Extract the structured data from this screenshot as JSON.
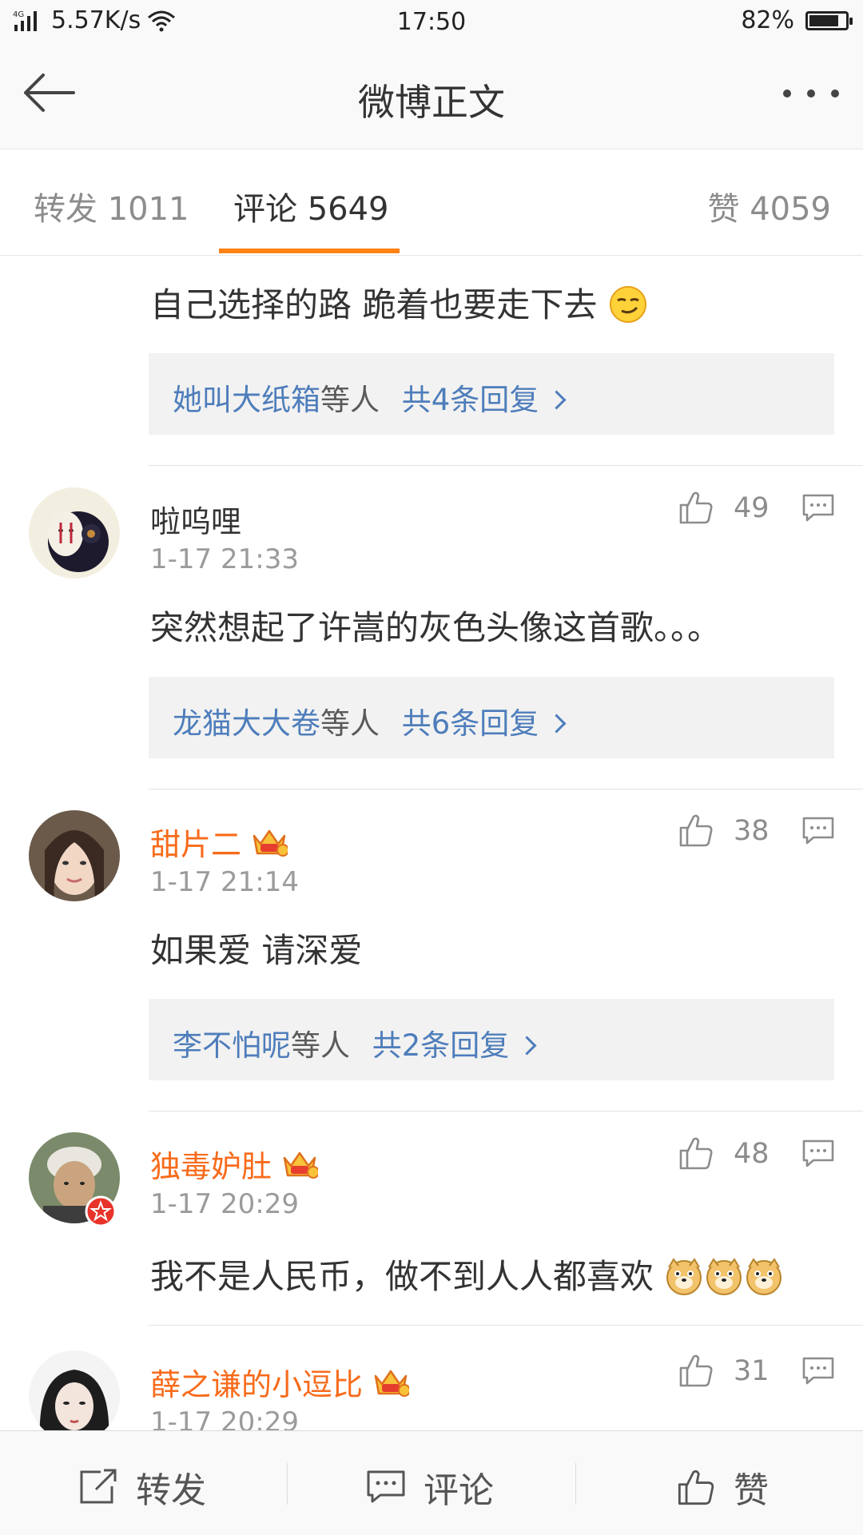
{
  "status_bar": {
    "network": "4G",
    "speed": "5.57K/s",
    "time": "17:50",
    "battery_percent": "82%",
    "battery_level": 0.82
  },
  "header": {
    "title": "微博正文"
  },
  "tabs": {
    "repost": "转发 1011",
    "comments": "评论 5649",
    "likes": "赞 4059"
  },
  "comments": [
    {
      "text": "自己选择的路  跪着也要走下去",
      "emoji": "smirk",
      "reply": {
        "users": "她叫大纸箱",
        "suffix": "等人",
        "count": "共4条回复"
      }
    },
    {
      "username": "啦呜哩",
      "vip": false,
      "time": "1-17 21:33",
      "likes": "49",
      "text": "突然想起了许嵩的灰色头像这首歌。。。",
      "reply": {
        "users": "龙猫大大卷",
        "suffix": "等人",
        "count": "共6条回复"
      }
    },
    {
      "username": "甜片二",
      "vip": true,
      "time": "1-17 21:14",
      "likes": "38",
      "text": "如果爱 请深爱",
      "reply": {
        "users": "李不怕呢",
        "suffix": "等人",
        "count": "共2条回复"
      }
    },
    {
      "username": "独毒妒肚",
      "vip": true,
      "time": "1-17 20:29",
      "likes": "48",
      "text": "我不是人民币，做不到人人都喜欢",
      "emoji": "doge x3"
    },
    {
      "username": "薛之谦的小逗比",
      "vip": true,
      "time": "1-17 20:29",
      "likes": "31"
    }
  ],
  "bottom_bar": {
    "repost": "转发",
    "comment": "评论",
    "like": "赞"
  },
  "colors": {
    "accent": "#fe8215",
    "link_blue": "#4e7dbb",
    "vip_name": "#f86b1b"
  }
}
